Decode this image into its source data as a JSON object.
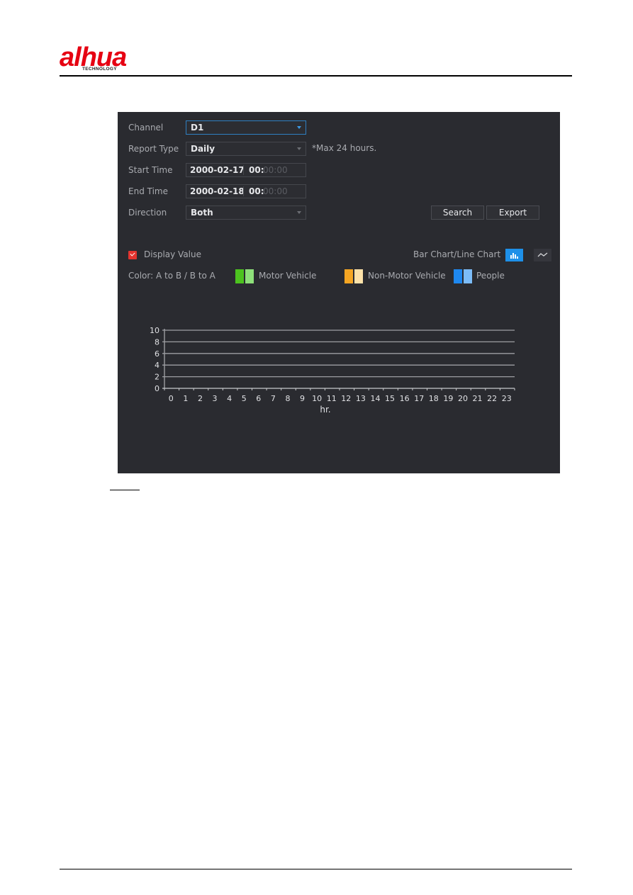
{
  "header": {
    "brand": "alhua",
    "brand_sub": "TECHNOLOGY"
  },
  "form": {
    "channel": {
      "label": "Channel",
      "value": "D1"
    },
    "report_type": {
      "label": "Report Type",
      "value": "Daily",
      "hint": "*Max 24 hours."
    },
    "start_time": {
      "label": "Start Time",
      "date": "2000-02-17",
      "hour": "00:",
      "minsec": "00:00"
    },
    "end_time": {
      "label": "End Time",
      "date": "2000-02-18",
      "hour": "00:",
      "minsec": "00:00"
    },
    "direction": {
      "label": "Direction",
      "value": "Both"
    },
    "search_label": "Search",
    "export_label": "Export"
  },
  "options": {
    "display_value_label": "Display Value",
    "display_value_checked": true,
    "chart_type_label": "Bar Chart/Line Chart",
    "chart_type_selected": "bar"
  },
  "legend": {
    "color_label": "Color: A to B / B to A",
    "items": [
      {
        "label": "Motor Vehicle",
        "color_ab": "#4cc31f",
        "color_ba": "#8ee07a"
      },
      {
        "label": "Non-Motor Vehicle",
        "color_ab": "#f5a623",
        "color_ba": "#fde2a9"
      },
      {
        "label": "People",
        "color_ab": "#1e88f0",
        "color_ba": "#7cbcf8"
      }
    ]
  },
  "chart_data": {
    "type": "bar",
    "title": "",
    "xlabel": "hr.",
    "ylabel": "",
    "categories": [
      "0",
      "1",
      "2",
      "3",
      "4",
      "5",
      "6",
      "7",
      "8",
      "9",
      "10",
      "11",
      "12",
      "13",
      "14",
      "15",
      "16",
      "17",
      "18",
      "19",
      "20",
      "21",
      "22",
      "23"
    ],
    "y_ticks": [
      "0",
      "2",
      "4",
      "6",
      "8",
      "10"
    ],
    "ylim": [
      0,
      10
    ],
    "grid": true,
    "series": [
      {
        "name": "Motor Vehicle",
        "values": []
      },
      {
        "name": "Non-Motor Vehicle",
        "values": []
      },
      {
        "name": "People",
        "values": []
      }
    ]
  }
}
